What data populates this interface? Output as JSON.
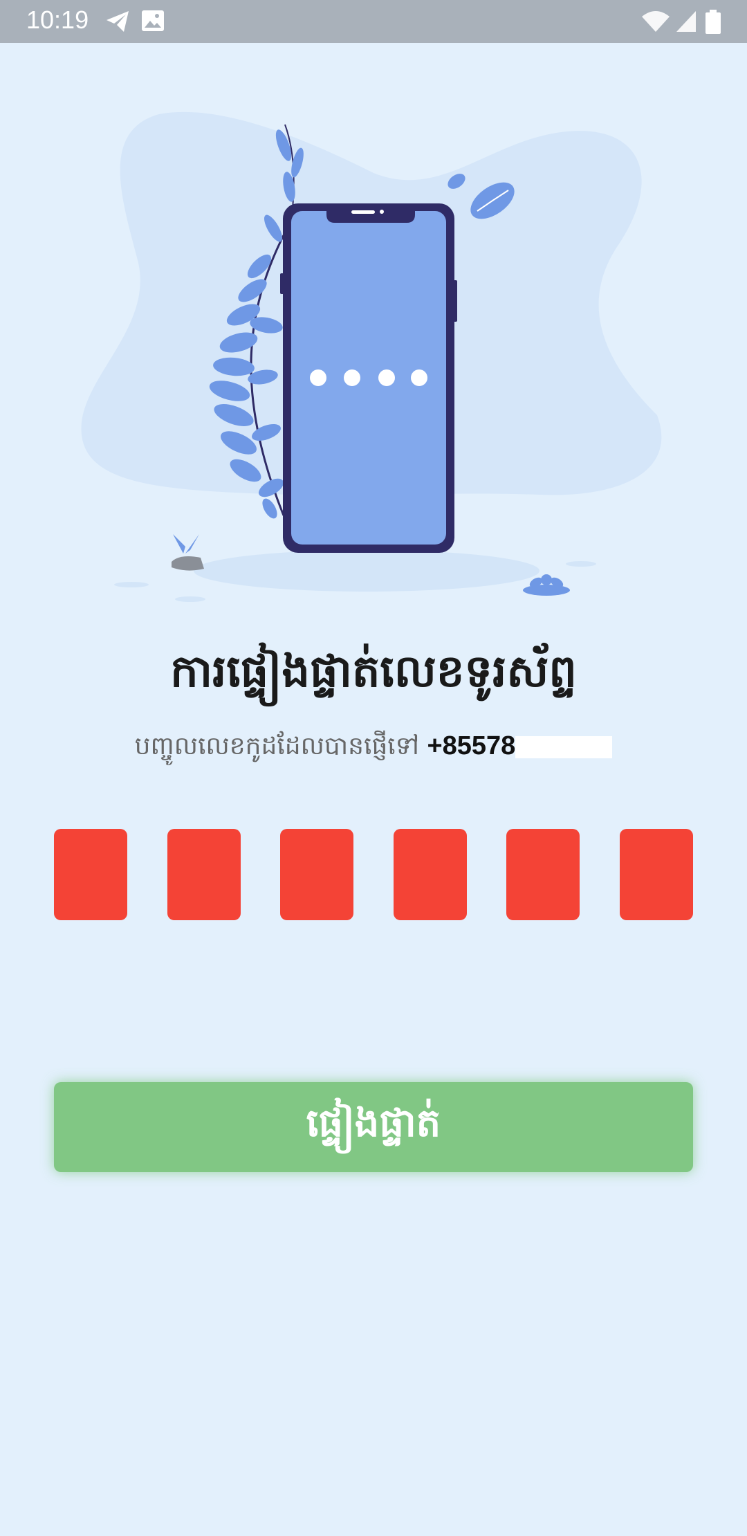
{
  "status_bar": {
    "time": "10:19",
    "icons": [
      "telegram-icon",
      "image-icon",
      "wifi-icon",
      "signal-icon",
      "battery-icon"
    ]
  },
  "verify": {
    "title": "ការផ្ទៀងផ្ទាត់លេខទូរស័ព្ទ",
    "subtitle": "បញ្ចូលលេខកូដដែលបានផ្ញើទៅ",
    "phone": "+85578",
    "otp_digits": [
      "",
      "",
      "",
      "",
      "",
      ""
    ],
    "button_label": "ផ្ទៀងផ្ទាត់"
  },
  "colors": {
    "background": "#e3f0fc",
    "otp_box": "#f44336",
    "button": "#81c784",
    "phone_frame": "#2f2b66",
    "phone_screen": "#82a8ec"
  }
}
